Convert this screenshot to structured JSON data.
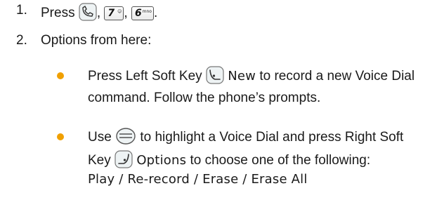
{
  "colors": {
    "bullet": "#f0a000",
    "text": "#1a1a1a"
  },
  "steps": [
    {
      "number": "1.",
      "text_start": "Press",
      "sep1": ",",
      "sep2": ",",
      "end": "."
    },
    {
      "number": "2.",
      "text": "Options from here:"
    }
  ],
  "keys": {
    "talk_icon": "talk-key-icon",
    "key7": {
      "digit": "7",
      "sub": "☺"
    },
    "key6": {
      "digit": "6",
      "sub": "mno"
    },
    "nav_icon": "navigation-key-icon",
    "right_soft_icon": "right-soft-key-icon"
  },
  "bullets": [
    {
      "line1_start": "Press Left Soft Key",
      "line1_ui": "New",
      "line1_end": "to record a new Voice Dial",
      "line2": "command. Follow the phone’s prompts."
    },
    {
      "line1_start": "Use",
      "line1_end": "to highlight a Voice Dial and press Right Soft",
      "line2_start": "Key",
      "line2_ui": "Options",
      "line2_end": "to choose one of the following:",
      "line3_ui": "Play / Re-record / Erase / Erase All"
    }
  ]
}
